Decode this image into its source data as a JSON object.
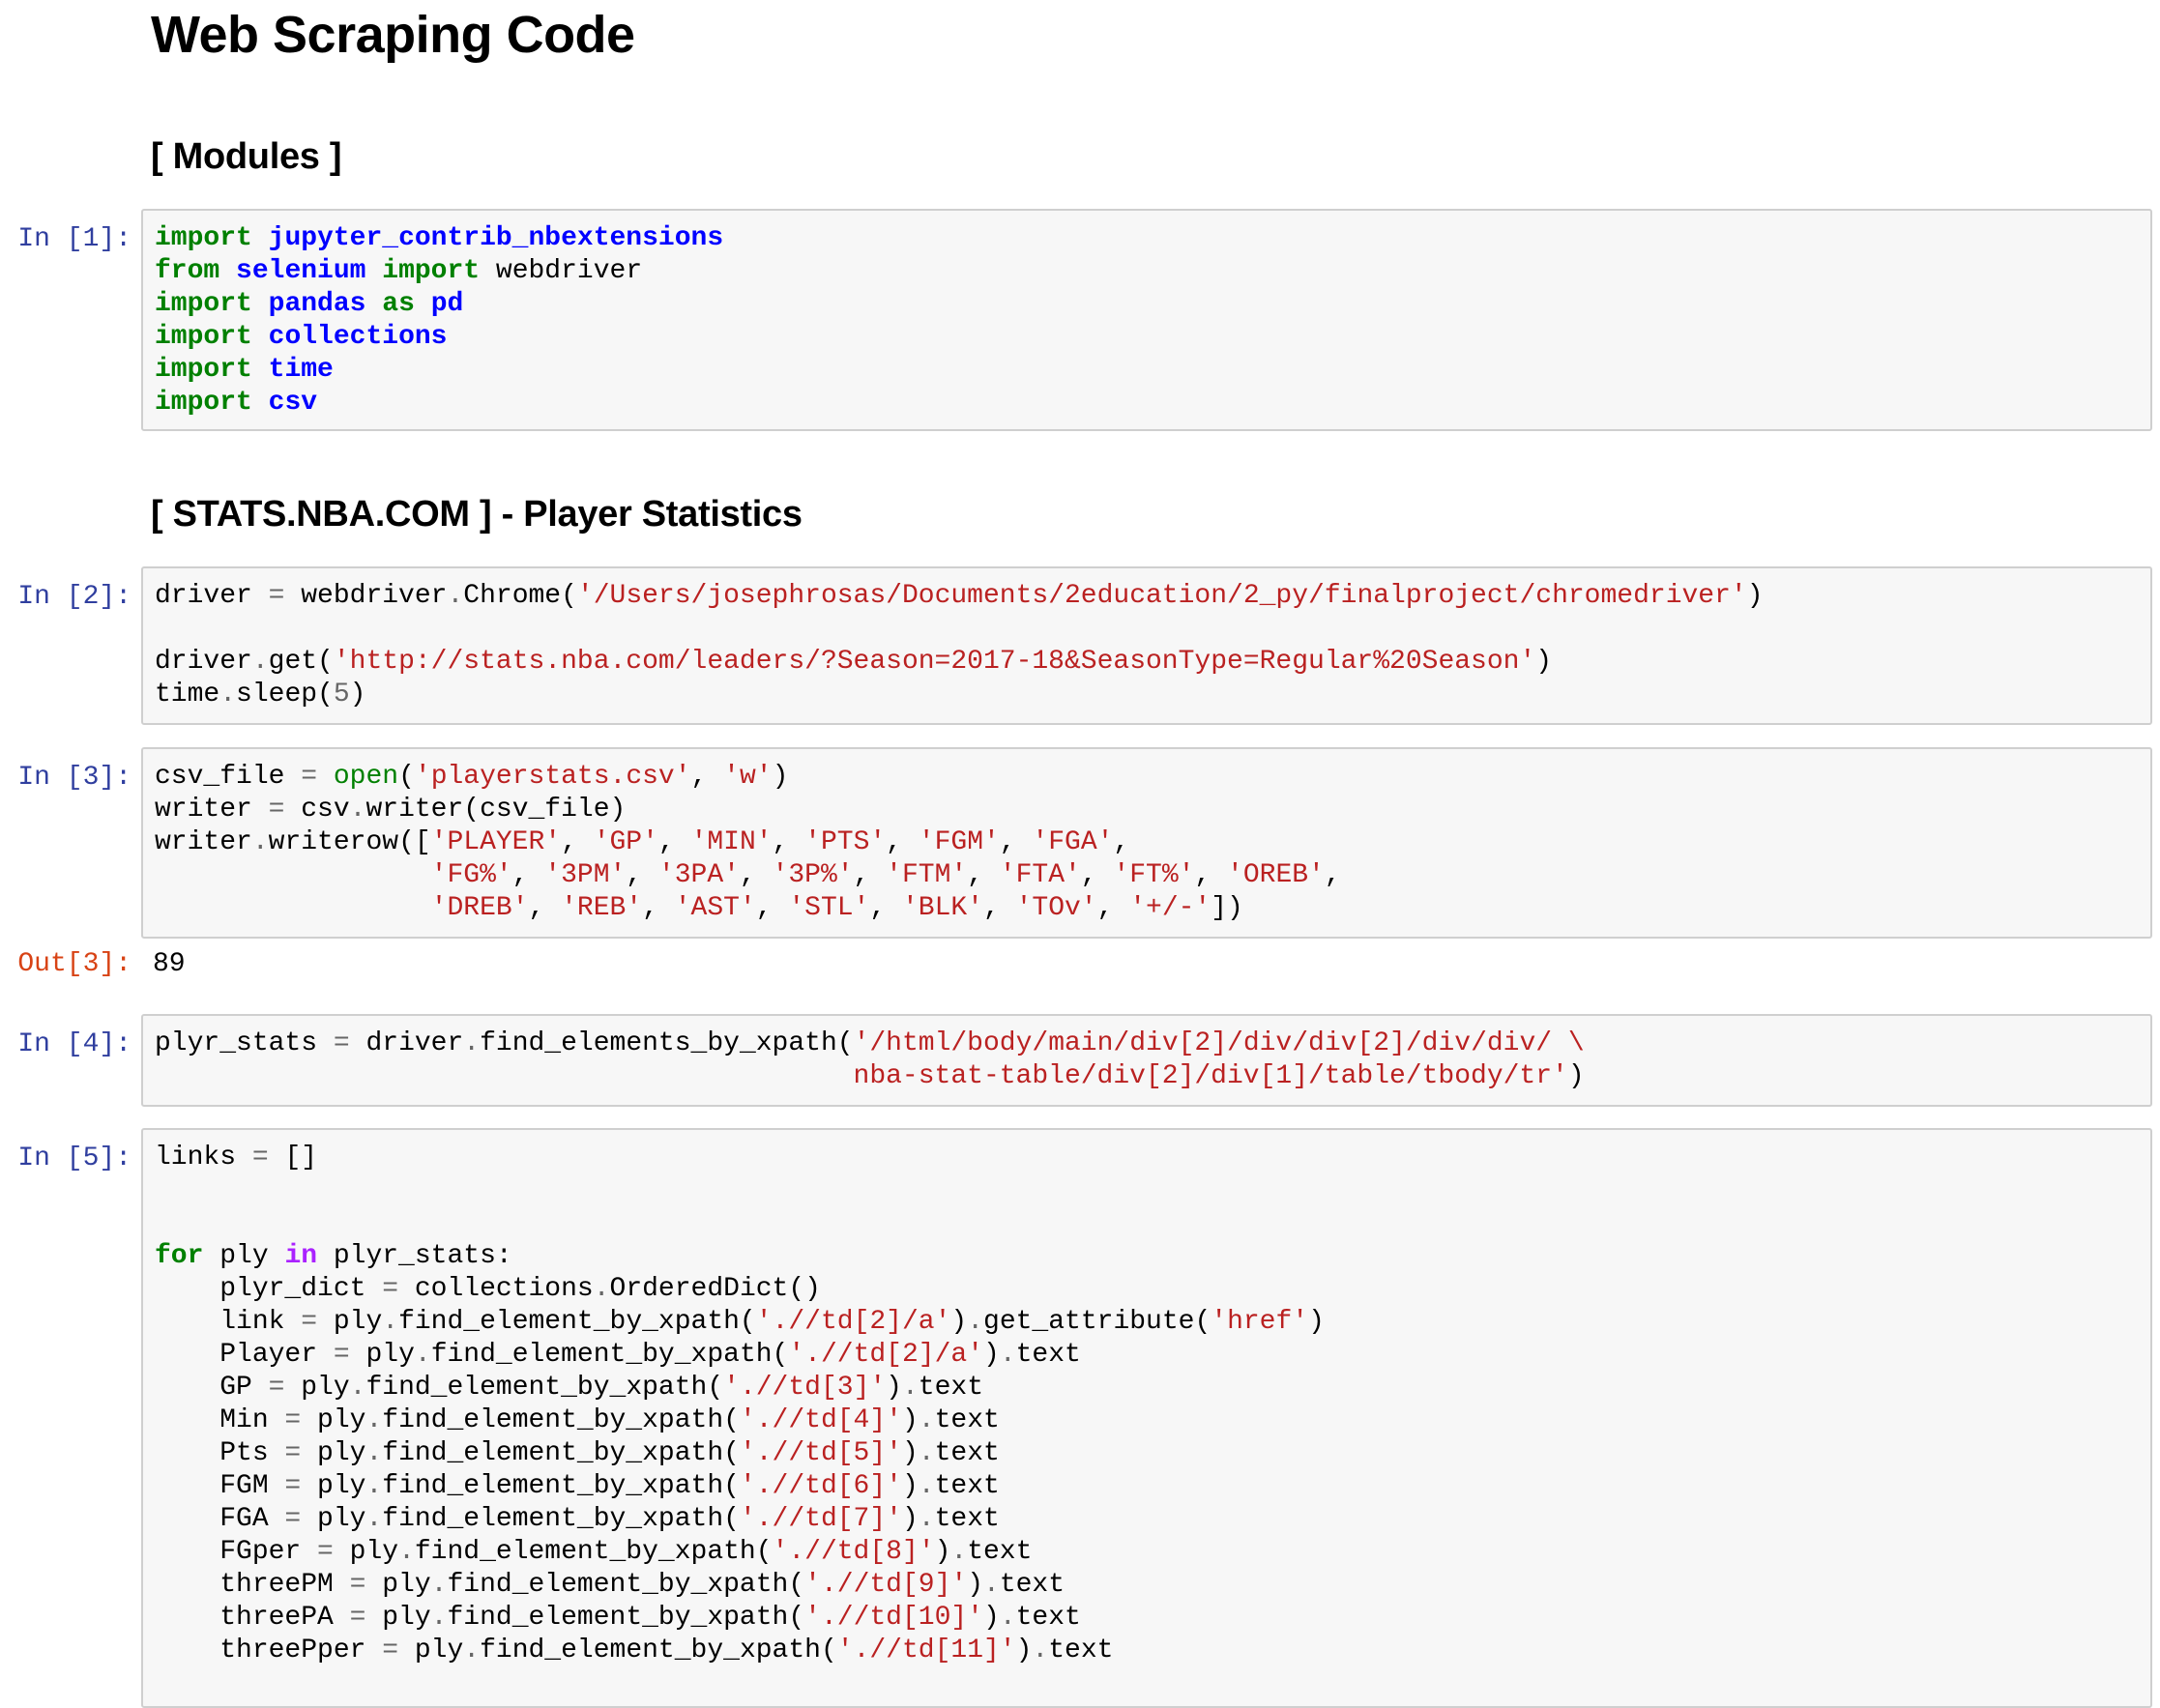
{
  "headings": {
    "title": "Web Scraping Code",
    "modules": "[ Modules ]",
    "stats": "[ STATS.NBA.COM ] - Player Statistics"
  },
  "cells": [
    {
      "prompt": "In [1]:",
      "lines": [
        [
          [
            "k",
            "import"
          ],
          [
            "p",
            " "
          ],
          [
            "nn",
            "jupyter_contrib_nbextensions"
          ]
        ],
        [
          [
            "k",
            "from"
          ],
          [
            "p",
            " "
          ],
          [
            "nn",
            "selenium"
          ],
          [
            "p",
            " "
          ],
          [
            "k",
            "import"
          ],
          [
            "p",
            " webdriver"
          ]
        ],
        [
          [
            "k",
            "import"
          ],
          [
            "p",
            " "
          ],
          [
            "nn",
            "pandas"
          ],
          [
            "p",
            " "
          ],
          [
            "k",
            "as"
          ],
          [
            "p",
            " "
          ],
          [
            "nn",
            "pd"
          ]
        ],
        [
          [
            "k",
            "import"
          ],
          [
            "p",
            " "
          ],
          [
            "nn",
            "collections"
          ]
        ],
        [
          [
            "k",
            "import"
          ],
          [
            "p",
            " "
          ],
          [
            "nn",
            "time"
          ]
        ],
        [
          [
            "k",
            "import"
          ],
          [
            "p",
            " "
          ],
          [
            "nn",
            "csv"
          ]
        ]
      ]
    },
    {
      "prompt": "In [2]:",
      "lines": [
        [
          [
            "p",
            "driver "
          ],
          [
            "o",
            "="
          ],
          [
            "p",
            " webdriver"
          ],
          [
            "o",
            "."
          ],
          [
            "p",
            "Chrome("
          ],
          [
            "s",
            "'/Users/josephrosas/Documents/2education/2_py/finalproject/chromedriver'"
          ],
          [
            "p",
            ")"
          ]
        ],
        [],
        [
          [
            "p",
            "driver"
          ],
          [
            "o",
            "."
          ],
          [
            "p",
            "get("
          ],
          [
            "s",
            "'http://stats.nba.com/leaders/?Season=2017-18&SeasonType=Regular%20Season'"
          ],
          [
            "p",
            ")"
          ]
        ],
        [
          [
            "p",
            "time"
          ],
          [
            "o",
            "."
          ],
          [
            "p",
            "sleep("
          ],
          [
            "mi",
            "5"
          ],
          [
            "p",
            ")"
          ]
        ]
      ]
    },
    {
      "prompt": "In [3]:",
      "lines": [
        [
          [
            "p",
            "csv_file "
          ],
          [
            "o",
            "="
          ],
          [
            "p",
            " "
          ],
          [
            "nb",
            "open"
          ],
          [
            "p",
            "("
          ],
          [
            "s",
            "'playerstats.csv'"
          ],
          [
            "p",
            ", "
          ],
          [
            "s",
            "'w'"
          ],
          [
            "p",
            ")"
          ]
        ],
        [
          [
            "p",
            "writer "
          ],
          [
            "o",
            "="
          ],
          [
            "p",
            " csv"
          ],
          [
            "o",
            "."
          ],
          [
            "p",
            "writer(csv_file)"
          ]
        ],
        [
          [
            "p",
            "writer"
          ],
          [
            "o",
            "."
          ],
          [
            "p",
            "writerow(["
          ],
          [
            "s",
            "'PLAYER'"
          ],
          [
            "p",
            ", "
          ],
          [
            "s",
            "'GP'"
          ],
          [
            "p",
            ", "
          ],
          [
            "s",
            "'MIN'"
          ],
          [
            "p",
            ", "
          ],
          [
            "s",
            "'PTS'"
          ],
          [
            "p",
            ", "
          ],
          [
            "s",
            "'FGM'"
          ],
          [
            "p",
            ", "
          ],
          [
            "s",
            "'FGA'"
          ],
          [
            "p",
            ","
          ]
        ],
        [
          [
            "p",
            "                 "
          ],
          [
            "s",
            "'FG%'"
          ],
          [
            "p",
            ", "
          ],
          [
            "s",
            "'3PM'"
          ],
          [
            "p",
            ", "
          ],
          [
            "s",
            "'3PA'"
          ],
          [
            "p",
            ", "
          ],
          [
            "s",
            "'3P%'"
          ],
          [
            "p",
            ", "
          ],
          [
            "s",
            "'FTM'"
          ],
          [
            "p",
            ", "
          ],
          [
            "s",
            "'FTA'"
          ],
          [
            "p",
            ", "
          ],
          [
            "s",
            "'FT%'"
          ],
          [
            "p",
            ", "
          ],
          [
            "s",
            "'OREB'"
          ],
          [
            "p",
            ","
          ]
        ],
        [
          [
            "p",
            "                 "
          ],
          [
            "s",
            "'DREB'"
          ],
          [
            "p",
            ", "
          ],
          [
            "s",
            "'REB'"
          ],
          [
            "p",
            ", "
          ],
          [
            "s",
            "'AST'"
          ],
          [
            "p",
            ", "
          ],
          [
            "s",
            "'STL'"
          ],
          [
            "p",
            ", "
          ],
          [
            "s",
            "'BLK'"
          ],
          [
            "p",
            ", "
          ],
          [
            "s",
            "'TOv'"
          ],
          [
            "p",
            ", "
          ],
          [
            "s",
            "'+/-'"
          ],
          [
            "p",
            "])"
          ]
        ]
      ]
    },
    {
      "prompt": "In [4]:",
      "lines": [
        [
          [
            "p",
            "plyr_stats "
          ],
          [
            "o",
            "="
          ],
          [
            "p",
            " driver"
          ],
          [
            "o",
            "."
          ],
          [
            "p",
            "find_elements_by_xpath("
          ],
          [
            "s",
            "'/html/body/main/div[2]/div/div[2]/div/div/ \\"
          ]
        ],
        [
          [
            "s",
            "                                           nba-stat-table/div[2]/div[1]/table/tbody/tr'"
          ],
          [
            "p",
            ")"
          ]
        ]
      ]
    },
    {
      "prompt": "In [5]:",
      "lines": [
        [
          [
            "p",
            "links "
          ],
          [
            "o",
            "="
          ],
          [
            "p",
            " []"
          ]
        ],
        [],
        [],
        [
          [
            "k",
            "for"
          ],
          [
            "p",
            " ply "
          ],
          [
            "ow",
            "in"
          ],
          [
            "p",
            " plyr_stats:"
          ]
        ],
        [
          [
            "p",
            "    plyr_dict "
          ],
          [
            "o",
            "="
          ],
          [
            "p",
            " collections"
          ],
          [
            "o",
            "."
          ],
          [
            "p",
            "OrderedDict()"
          ]
        ],
        [
          [
            "p",
            "    link "
          ],
          [
            "o",
            "="
          ],
          [
            "p",
            " ply"
          ],
          [
            "o",
            "."
          ],
          [
            "p",
            "find_element_by_xpath("
          ],
          [
            "s",
            "'.//td[2]/a'"
          ],
          [
            "p",
            ")"
          ],
          [
            "o",
            "."
          ],
          [
            "p",
            "get_attribute("
          ],
          [
            "s",
            "'href'"
          ],
          [
            "p",
            ")"
          ]
        ],
        [
          [
            "p",
            "    Player "
          ],
          [
            "o",
            "="
          ],
          [
            "p",
            " ply"
          ],
          [
            "o",
            "."
          ],
          [
            "p",
            "find_element_by_xpath("
          ],
          [
            "s",
            "'.//td[2]/a'"
          ],
          [
            "p",
            ")"
          ],
          [
            "o",
            "."
          ],
          [
            "p",
            "text"
          ]
        ],
        [
          [
            "p",
            "    GP "
          ],
          [
            "o",
            "="
          ],
          [
            "p",
            " ply"
          ],
          [
            "o",
            "."
          ],
          [
            "p",
            "find_element_by_xpath("
          ],
          [
            "s",
            "'.//td[3]'"
          ],
          [
            "p",
            ")"
          ],
          [
            "o",
            "."
          ],
          [
            "p",
            "text"
          ]
        ],
        [
          [
            "p",
            "    Min "
          ],
          [
            "o",
            "="
          ],
          [
            "p",
            " ply"
          ],
          [
            "o",
            "."
          ],
          [
            "p",
            "find_element_by_xpath("
          ],
          [
            "s",
            "'.//td[4]'"
          ],
          [
            "p",
            ")"
          ],
          [
            "o",
            "."
          ],
          [
            "p",
            "text"
          ]
        ],
        [
          [
            "p",
            "    Pts "
          ],
          [
            "o",
            "="
          ],
          [
            "p",
            " ply"
          ],
          [
            "o",
            "."
          ],
          [
            "p",
            "find_element_by_xpath("
          ],
          [
            "s",
            "'.//td[5]'"
          ],
          [
            "p",
            ")"
          ],
          [
            "o",
            "."
          ],
          [
            "p",
            "text"
          ]
        ],
        [
          [
            "p",
            "    FGM "
          ],
          [
            "o",
            "="
          ],
          [
            "p",
            " ply"
          ],
          [
            "o",
            "."
          ],
          [
            "p",
            "find_element_by_xpath("
          ],
          [
            "s",
            "'.//td[6]'"
          ],
          [
            "p",
            ")"
          ],
          [
            "o",
            "."
          ],
          [
            "p",
            "text"
          ]
        ],
        [
          [
            "p",
            "    FGA "
          ],
          [
            "o",
            "="
          ],
          [
            "p",
            " ply"
          ],
          [
            "o",
            "."
          ],
          [
            "p",
            "find_element_by_xpath("
          ],
          [
            "s",
            "'.//td[7]'"
          ],
          [
            "p",
            ")"
          ],
          [
            "o",
            "."
          ],
          [
            "p",
            "text"
          ]
        ],
        [
          [
            "p",
            "    FGper "
          ],
          [
            "o",
            "="
          ],
          [
            "p",
            " ply"
          ],
          [
            "o",
            "."
          ],
          [
            "p",
            "find_element_by_xpath("
          ],
          [
            "s",
            "'.//td[8]'"
          ],
          [
            "p",
            ")"
          ],
          [
            "o",
            "."
          ],
          [
            "p",
            "text"
          ]
        ],
        [
          [
            "p",
            "    threePM "
          ],
          [
            "o",
            "="
          ],
          [
            "p",
            " ply"
          ],
          [
            "o",
            "."
          ],
          [
            "p",
            "find_element_by_xpath("
          ],
          [
            "s",
            "'.//td[9]'"
          ],
          [
            "p",
            ")"
          ],
          [
            "o",
            "."
          ],
          [
            "p",
            "text"
          ]
        ],
        [
          [
            "p",
            "    threePA "
          ],
          [
            "o",
            "="
          ],
          [
            "p",
            " ply"
          ],
          [
            "o",
            "."
          ],
          [
            "p",
            "find_element_by_xpath("
          ],
          [
            "s",
            "'.//td[10]'"
          ],
          [
            "p",
            ")"
          ],
          [
            "o",
            "."
          ],
          [
            "p",
            "text"
          ]
        ],
        [
          [
            "p",
            "    threePper "
          ],
          [
            "o",
            "="
          ],
          [
            "p",
            " ply"
          ],
          [
            "o",
            "."
          ],
          [
            "p",
            "find_element_by_xpath("
          ],
          [
            "s",
            "'.//td[11]'"
          ],
          [
            "p",
            ")"
          ],
          [
            "o",
            "."
          ],
          [
            "p",
            "text"
          ]
        ]
      ]
    }
  ],
  "outputs": [
    {
      "prompt": "Out[3]:",
      "text": "89"
    }
  ]
}
